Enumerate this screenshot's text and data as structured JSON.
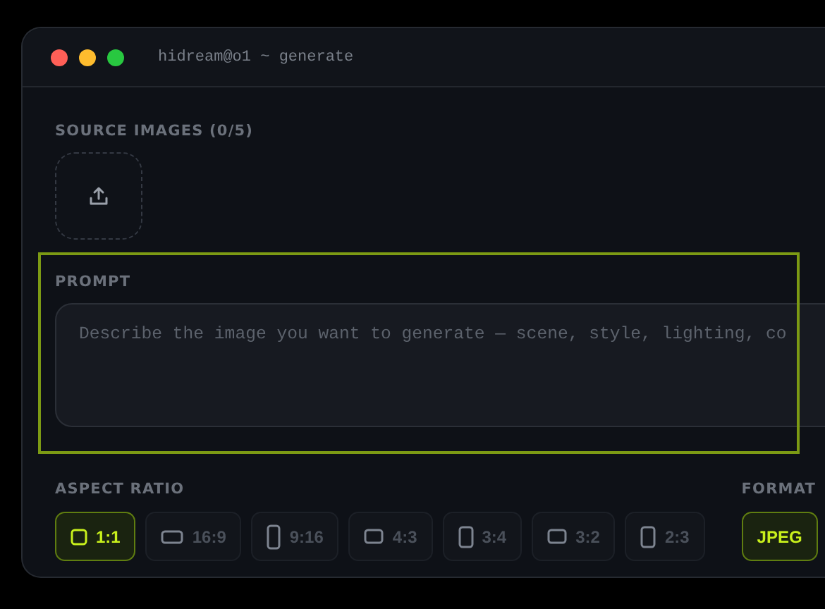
{
  "window": {
    "title": "hidream@o1 ~ generate"
  },
  "source_images": {
    "label": "SOURCE IMAGES (0/5)"
  },
  "prompt": {
    "label": "PROMPT",
    "placeholder": "Describe the image you want to generate — scene, style, lighting, co",
    "highlighted": true
  },
  "aspect_ratio": {
    "label": "ASPECT RATIO",
    "options": [
      {
        "label": "1:1",
        "kind": "square",
        "selected": true
      },
      {
        "label": "16:9",
        "kind": "wide",
        "selected": false
      },
      {
        "label": "9:16",
        "kind": "tall",
        "selected": false
      },
      {
        "label": "4:3",
        "kind": "landscape",
        "selected": false
      },
      {
        "label": "3:4",
        "kind": "portrait",
        "selected": false
      },
      {
        "label": "3:2",
        "kind": "landscape",
        "selected": false
      },
      {
        "label": "2:3",
        "kind": "portrait",
        "selected": false
      }
    ]
  },
  "format": {
    "label": "FORMAT",
    "options": [
      {
        "label": "JPEG",
        "selected": true
      }
    ]
  }
}
